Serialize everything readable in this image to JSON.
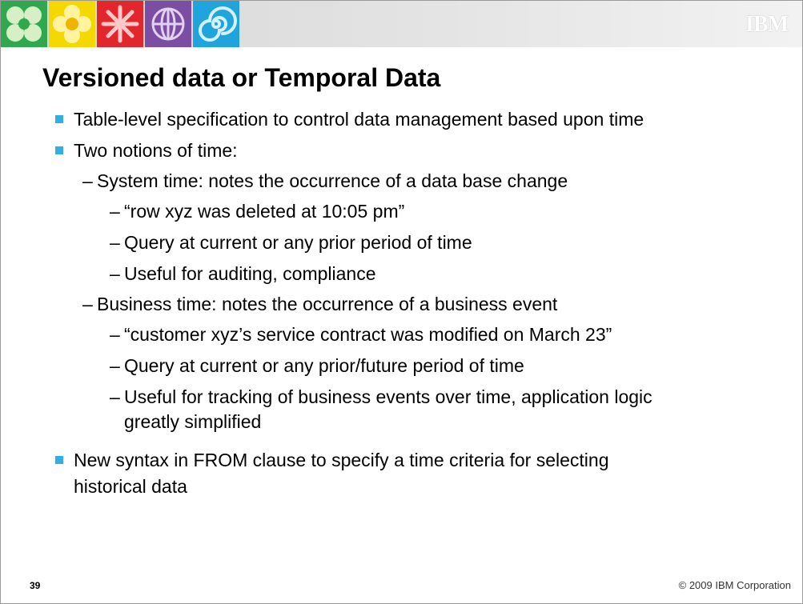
{
  "header": {
    "brand": "IBM"
  },
  "title": "Versioned data or Temporal Data",
  "bullets": [
    {
      "level": 1,
      "text": "Table-level specification to control data management based upon time"
    },
    {
      "level": 1,
      "text": "Two notions of time:"
    },
    {
      "level": 2,
      "text": "System time: notes the occurrence of a data base change"
    },
    {
      "level": 3,
      "text": "“row xyz was deleted at 10:05 pm”"
    },
    {
      "level": 3,
      "text": "Query at current or any prior period of time"
    },
    {
      "level": 3,
      "text": "Useful for auditing, compliance"
    },
    {
      "level": 2,
      "text": "Business time:  notes the occurrence of a business event"
    },
    {
      "level": 3,
      "text": "“customer xyz’s service contract was modified on March 23”"
    },
    {
      "level": 3,
      "text": "Query at current or any prior/future period of time"
    },
    {
      "level": 3,
      "text": "Useful for tracking of business events over time, application logic"
    },
    {
      "level": 3,
      "text": "greatly simplified",
      "continuation": true
    },
    {
      "level": 1,
      "text": "New syntax in FROM clause to specify a time criteria for selecting"
    },
    {
      "level": 1,
      "text": "historical data",
      "continuation": true
    }
  ],
  "footer": {
    "page_number": "39",
    "copyright": "© 2009 IBM Corporation"
  },
  "colors": {
    "bullet": "#30aee5",
    "tile_green": "#2fa84f",
    "tile_yellow": "#f5d800",
    "tile_red": "#e3262b",
    "tile_purple": "#7b4da3",
    "tile_blue": "#1fa5dc"
  }
}
